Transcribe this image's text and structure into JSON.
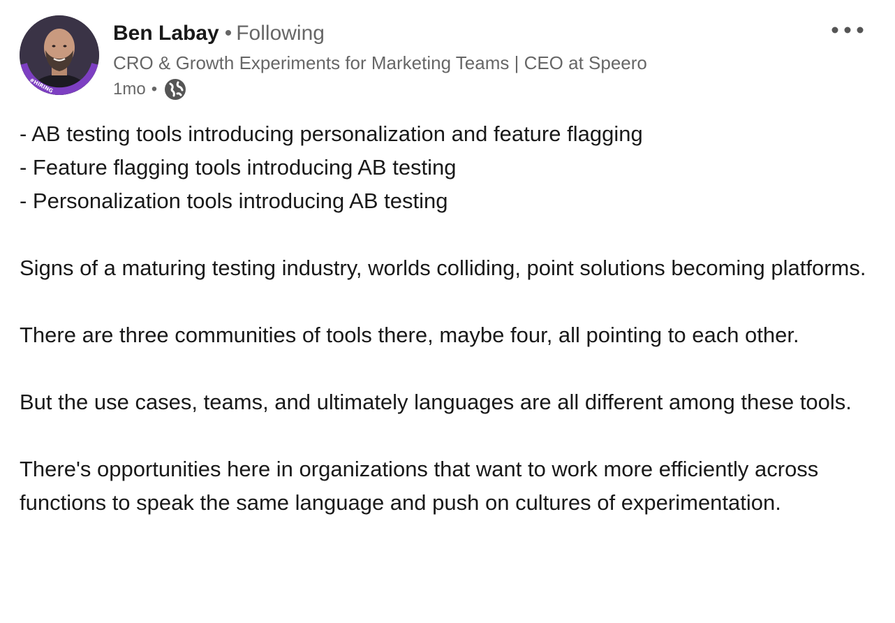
{
  "post": {
    "author": {
      "name": "Ben Labay",
      "separator": "•",
      "follow_status": "Following",
      "headline": "CRO & Growth Experiments for Marketing Teams | CEO at Speero",
      "avatar_badge": "#HIRING"
    },
    "meta": {
      "time": "1mo",
      "separator": "•",
      "visibility_icon": "globe-icon"
    },
    "more_icon": "ellipsis-icon",
    "paragraphs": [
      "- AB testing tools introducing personalization and feature flagging\n- Feature flagging tools introducing AB testing\n- Personalization tools introducing AB testing",
      "Signs of a maturing testing industry, worlds colliding, point solutions becoming platforms.",
      "There are three communities of tools there, maybe four, all pointing to each other.",
      "But the use cases, teams, and ultimately languages are all different among these tools.",
      "There's opportunities here in organizations that want to work more efficiently across functions to speak the same language and push on cultures of experimentation."
    ]
  },
  "colors": {
    "avatar_ring": "#7d3fc2",
    "text_primary": "#1a1a1a",
    "text_secondary": "#666666"
  }
}
